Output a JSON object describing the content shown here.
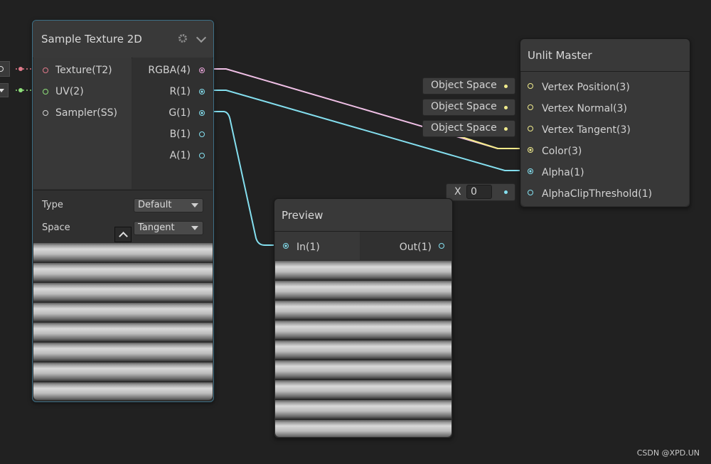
{
  "sample_node": {
    "title": "Sample Texture 2D",
    "inputs": [
      {
        "label": "Texture(T2)",
        "color": "#e07a8a"
      },
      {
        "label": "UV(2)",
        "color": "#8ee07a"
      },
      {
        "label": "Sampler(SS)",
        "color": "#d0d0d0"
      }
    ],
    "outputs": [
      {
        "label": "RGBA(4)",
        "color": "#e6a3d8"
      },
      {
        "label": "R(1)",
        "color": "#84e0f0"
      },
      {
        "label": "G(1)",
        "color": "#84e0f0"
      },
      {
        "label": "B(1)",
        "color": "#84e0f0"
      },
      {
        "label": "A(1)",
        "color": "#84e0f0"
      }
    ],
    "type_label": "Type",
    "type_value": "Default",
    "space_label": "Space",
    "space_value": "Tangent"
  },
  "master_node": {
    "title": "Unlit Master",
    "inputs": [
      {
        "label": "Vertex Position(3)",
        "color": "#f0eb8c"
      },
      {
        "label": "Vertex Normal(3)",
        "color": "#f0eb8c"
      },
      {
        "label": "Vertex Tangent(3)",
        "color": "#f0eb8c"
      },
      {
        "label": "Color(3)",
        "color": "#f0eb8c"
      },
      {
        "label": "Alpha(1)",
        "color": "#84e0f0"
      },
      {
        "label": "AlphaClipThreshold(1)",
        "color": "#84e0f0"
      }
    ],
    "object_space": [
      "Object Space",
      "Object Space",
      "Object Space"
    ],
    "alpha_clip_axis": "X",
    "alpha_clip_value": "0"
  },
  "preview_node": {
    "title": "Preview",
    "input_label": "In(1)",
    "output_label": "Out(1)"
  },
  "colors": {
    "rgba_wire": "#f0c0e6",
    "color_wire": "#f5ea8a",
    "float_wire": "#84dfef",
    "selected_border": "#3d6f86"
  },
  "watermark": "CSDN @XPD.UN"
}
